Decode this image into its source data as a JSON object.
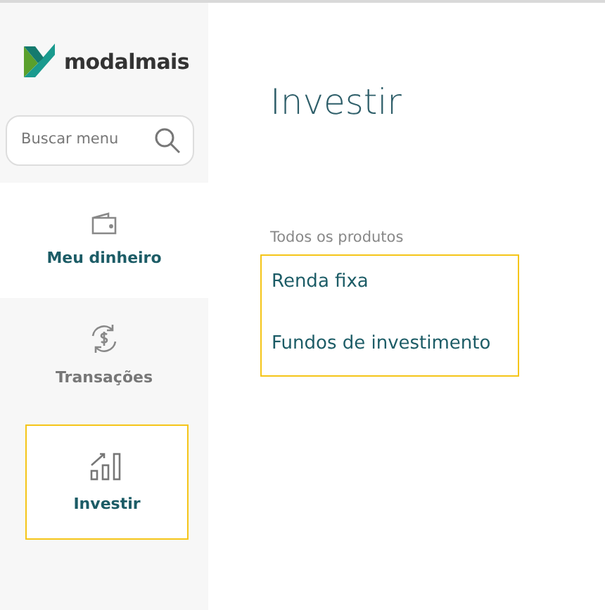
{
  "sidebar": {
    "logo": {
      "text": "modalmais"
    },
    "search": {
      "placeholder": "Buscar menu"
    },
    "items": [
      {
        "label": "Meu dinheiro",
        "kind": "wallet",
        "selected": false,
        "highlighted": true
      },
      {
        "label": "Transações",
        "kind": "exchange",
        "selected": false,
        "highlighted": false
      },
      {
        "label": "Investir",
        "kind": "chart",
        "selected": true,
        "highlighted": false
      }
    ]
  },
  "main": {
    "title": "Investir",
    "section_label": "Todos os produtos",
    "products": [
      {
        "label": "Renda fixa"
      },
      {
        "label": "Fundos de investimento"
      }
    ]
  }
}
